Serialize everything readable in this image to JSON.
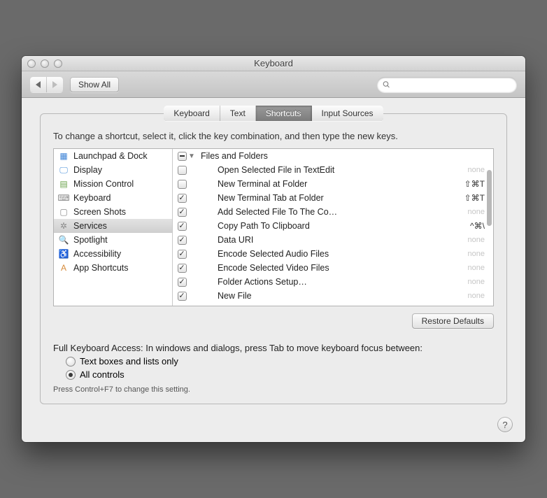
{
  "window": {
    "title": "Keyboard"
  },
  "toolbar": {
    "show_all": "Show All",
    "search_placeholder": ""
  },
  "tabs": {
    "items": [
      "Keyboard",
      "Text",
      "Shortcuts",
      "Input Sources"
    ],
    "active_index": 2
  },
  "instruction": "To change a shortcut, select it, click the key combination, and then type the new keys.",
  "sidebar": {
    "items": [
      {
        "label": "Launchpad & Dock",
        "icon": "launchpad-icon",
        "color": "#3b82d6"
      },
      {
        "label": "Display",
        "icon": "display-icon",
        "color": "#4a90d9"
      },
      {
        "label": "Mission Control",
        "icon": "mission-control-icon",
        "color": "#6aa24b"
      },
      {
        "label": "Keyboard",
        "icon": "keyboard-icon",
        "color": "#8a8a8a"
      },
      {
        "label": "Screen Shots",
        "icon": "screenshots-icon",
        "color": "#8a8a8a"
      },
      {
        "label": "Services",
        "icon": "services-icon",
        "color": "#8a8a8a"
      },
      {
        "label": "Spotlight",
        "icon": "spotlight-icon",
        "color": "#2d7ad6"
      },
      {
        "label": "Accessibility",
        "icon": "accessibility-icon",
        "color": "#2d7ad6"
      },
      {
        "label": "App Shortcuts",
        "icon": "app-shortcuts-icon",
        "color": "#d68a3a"
      }
    ],
    "selected_index": 5
  },
  "services": {
    "group": {
      "label": "Files and Folders",
      "state": "mixed",
      "expanded": true
    },
    "rows": [
      {
        "checked": false,
        "label": "Open Selected File in TextEdit",
        "shortcut": "none"
      },
      {
        "checked": false,
        "label": "New Terminal at Folder",
        "shortcut": "⇧⌘T"
      },
      {
        "checked": true,
        "label": "New Terminal Tab at Folder",
        "shortcut": "⇧⌘T"
      },
      {
        "checked": true,
        "label": "Add Selected File To The Co…",
        "shortcut": "none"
      },
      {
        "checked": true,
        "label": "Copy Path To Clipboard",
        "shortcut": "^⌘\\"
      },
      {
        "checked": true,
        "label": "Data URI",
        "shortcut": "none"
      },
      {
        "checked": true,
        "label": "Encode Selected Audio Files",
        "shortcut": "none"
      },
      {
        "checked": true,
        "label": "Encode Selected Video Files",
        "shortcut": "none"
      },
      {
        "checked": true,
        "label": "Folder Actions Setup…",
        "shortcut": "none"
      },
      {
        "checked": true,
        "label": "New File",
        "shortcut": "none"
      }
    ]
  },
  "restore_defaults": "Restore Defaults",
  "fka": {
    "label": "Full Keyboard Access: In windows and dialogs, press Tab to move keyboard focus between:",
    "options": [
      "Text boxes and lists only",
      "All controls"
    ],
    "selected_index": 1,
    "hint": "Press Control+F7 to change this setting."
  }
}
